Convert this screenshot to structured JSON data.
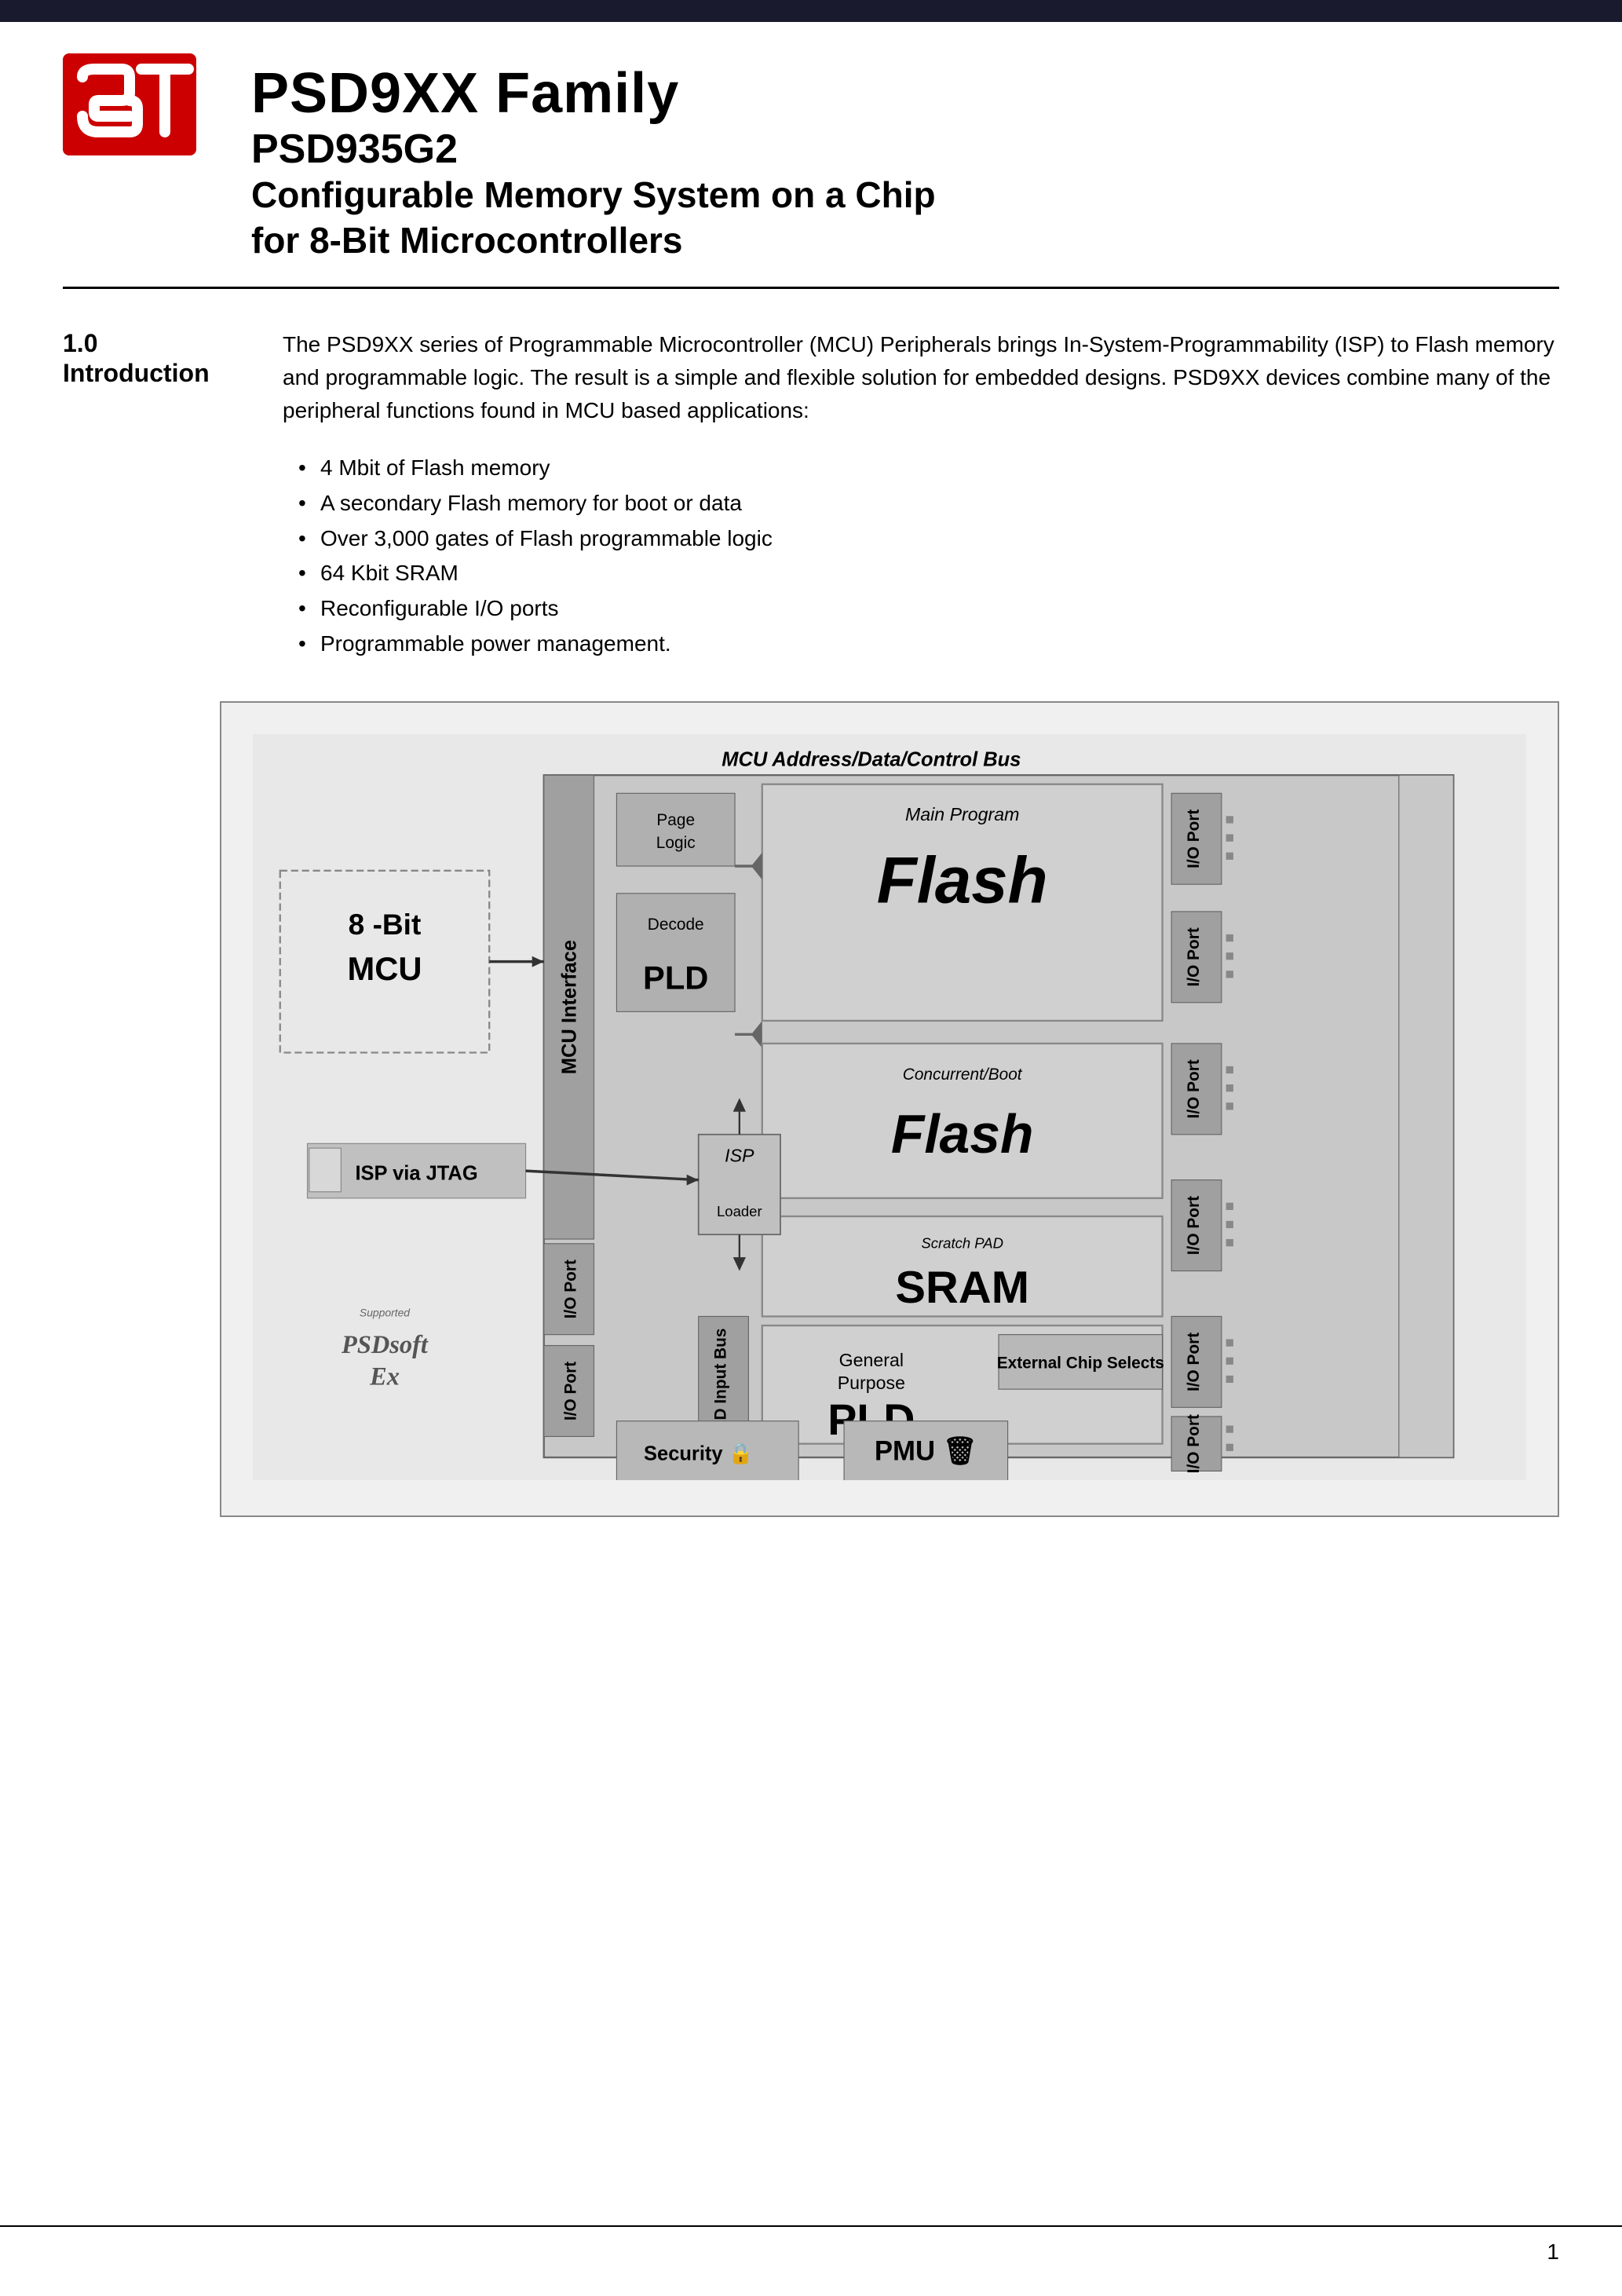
{
  "header": {
    "bar_color": "#1a1a2e",
    "main_title": "PSD9XX Family",
    "subtitle_model": "PSD935G2",
    "subtitle_desc": "Configurable Memory System on a Chip\nfor 8-Bit Microcontrollers"
  },
  "section": {
    "number": "1.0",
    "title": "Introduction",
    "intro_paragraph": "The PSD9XX series of Programmable Microcontroller (MCU) Peripherals brings In-System-Programmability (ISP) to Flash memory and programmable logic. The result is a simple and flexible solution for embedded designs. PSD9XX devices combine many of the peripheral functions found in MCU based applications:",
    "bullets": [
      "4 Mbit of Flash memory",
      "A secondary Flash memory for boot or data",
      "Over 3,000 gates of Flash programmable logic",
      "64 Kbit SRAM",
      "Reconfigurable I/O ports",
      "Programmable power management."
    ]
  },
  "diagram": {
    "top_label": "MCU Address/Data/Control Bus",
    "mcu_label": "8 -Bit\nMCU",
    "mcu_interface_label": "MCU Interface",
    "page_logic_label": "Page\nLogic",
    "main_program_label": "Main Program",
    "flash_main_label": "Flash",
    "decode_label": "Decode",
    "pld_decode_label": "PLD",
    "concurrent_boot_label": "Concurrent/Boot",
    "flash_boot_label": "Flash",
    "scratch_pad_label": "Scratch PAD",
    "sram_label": "SRAM",
    "isp_jtag_label": "ISP via JTAG",
    "isp_label": "ISP",
    "loader_label": "Loader",
    "general_purpose_label": "General\nPurpose",
    "pld_general_label": "PLD",
    "pld_input_bus_label": "PLD Input Bus",
    "external_chip_selects_label": "External Chip Selects",
    "security_label": "Security",
    "pmu_label": "PMU",
    "io_port_label": "I/O Port",
    "supported_label": "Supported"
  },
  "footer": {
    "page_number": "1"
  }
}
